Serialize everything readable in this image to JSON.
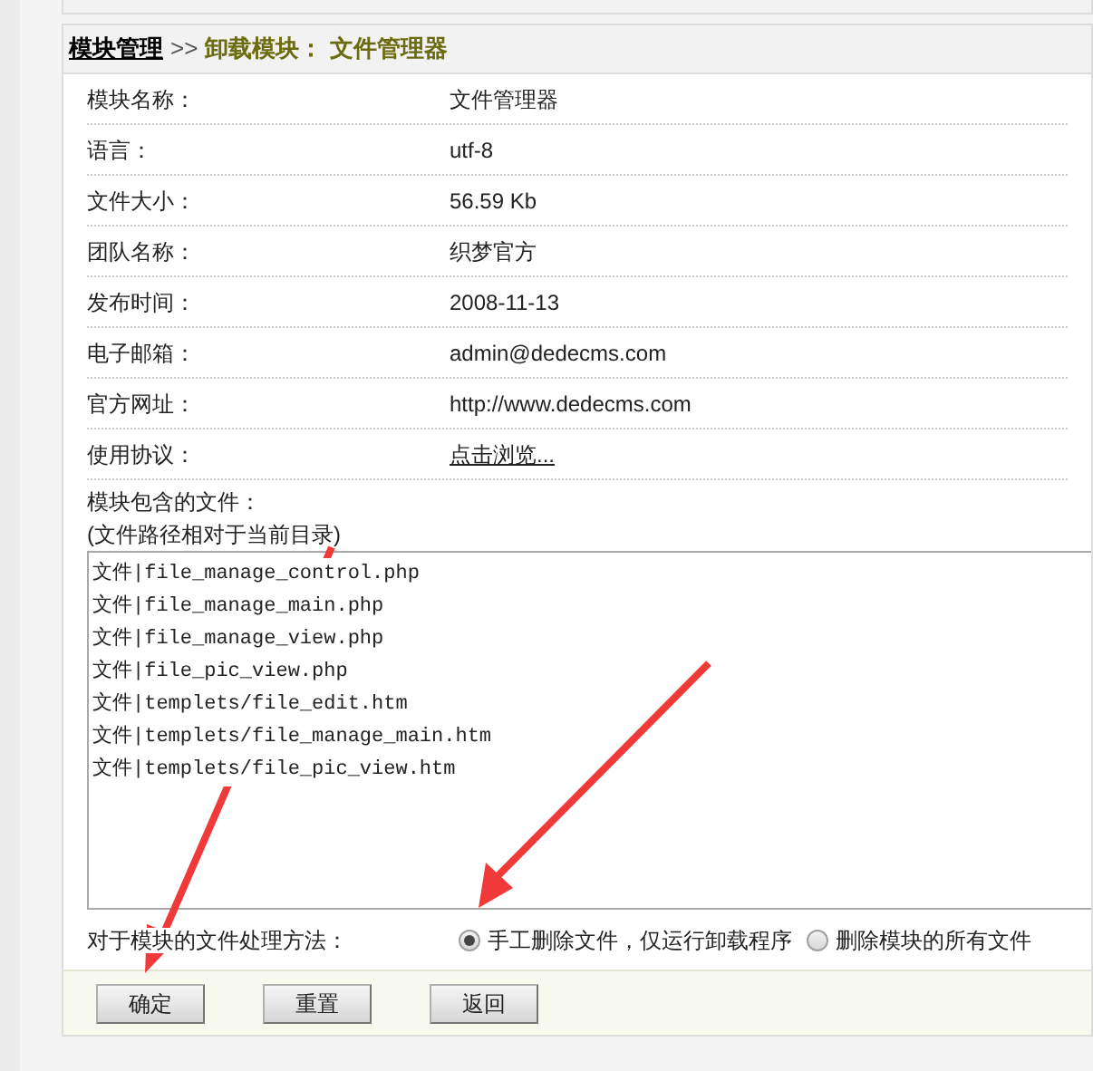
{
  "breadcrumb": {
    "link": "模块管理",
    "separator": ">>",
    "current": "卸载模块： 文件管理器"
  },
  "fields": [
    {
      "label": "模块名称：",
      "value": "文件管理器",
      "kind": "text"
    },
    {
      "label": "语言：",
      "value": "utf-8",
      "kind": "text"
    },
    {
      "label": "文件大小：",
      "value": "56.59 Kb",
      "kind": "text"
    },
    {
      "label": "团队名称：",
      "value": "织梦官方",
      "kind": "text"
    },
    {
      "label": "发布时间：",
      "value": "2008-11-13",
      "kind": "text"
    },
    {
      "label": "电子邮箱：",
      "value": "admin@dedecms.com",
      "kind": "text"
    },
    {
      "label": "官方网址：",
      "value": "http://www.dedecms.com",
      "kind": "text"
    },
    {
      "label": "使用协议：",
      "value": "点击浏览...",
      "kind": "link"
    }
  ],
  "files_label": "模块包含的文件：",
  "files_note": "(文件路径相对于当前目录)",
  "files": [
    "文件|file_manage_control.php",
    "文件|file_manage_main.php",
    "文件|file_manage_view.php",
    "文件|file_pic_view.php",
    "文件|templets/file_edit.htm",
    "文件|templets/file_manage_main.htm",
    "文件|templets/file_pic_view.htm"
  ],
  "method_label": "对于模块的文件处理方法：",
  "options": [
    {
      "label": "手工删除文件，仅运行卸载程序",
      "selected": true
    },
    {
      "label": "删除模块的所有文件",
      "selected": false
    }
  ],
  "buttons": [
    "确定",
    "重置",
    "返回"
  ]
}
